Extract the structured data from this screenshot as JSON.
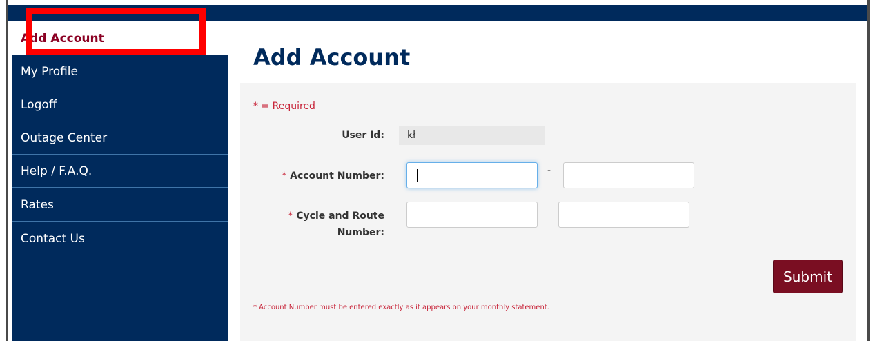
{
  "colors": {
    "navy": "#002a5c",
    "active_text": "#8b0023",
    "required_red": "#c8253a",
    "submit_bg": "#7a0e22",
    "highlight_red": "#ff0000"
  },
  "sidebar": {
    "active_item": "Add Account",
    "items": [
      {
        "label": "My Profile"
      },
      {
        "label": "Logoff"
      },
      {
        "label": "Outage Center"
      },
      {
        "label": "Help / F.A.Q."
      },
      {
        "label": "Rates"
      },
      {
        "label": "Contact Us"
      }
    ]
  },
  "main": {
    "title": "Add Account",
    "required_note": "* = Required",
    "user_id": {
      "label": "User Id:",
      "value": "kł"
    },
    "account_number": {
      "label": "Account Number:",
      "required_star": "*",
      "separator": "-",
      "value_1": "",
      "value_2": ""
    },
    "cycle_route": {
      "label_line1": "Cycle and Route",
      "label_line2": "Number:",
      "required_star": "*",
      "value_1": "",
      "value_2": ""
    },
    "submit_label": "Submit",
    "footnote": "* Account Number must be entered exactly as it appears on your monthly statement."
  }
}
